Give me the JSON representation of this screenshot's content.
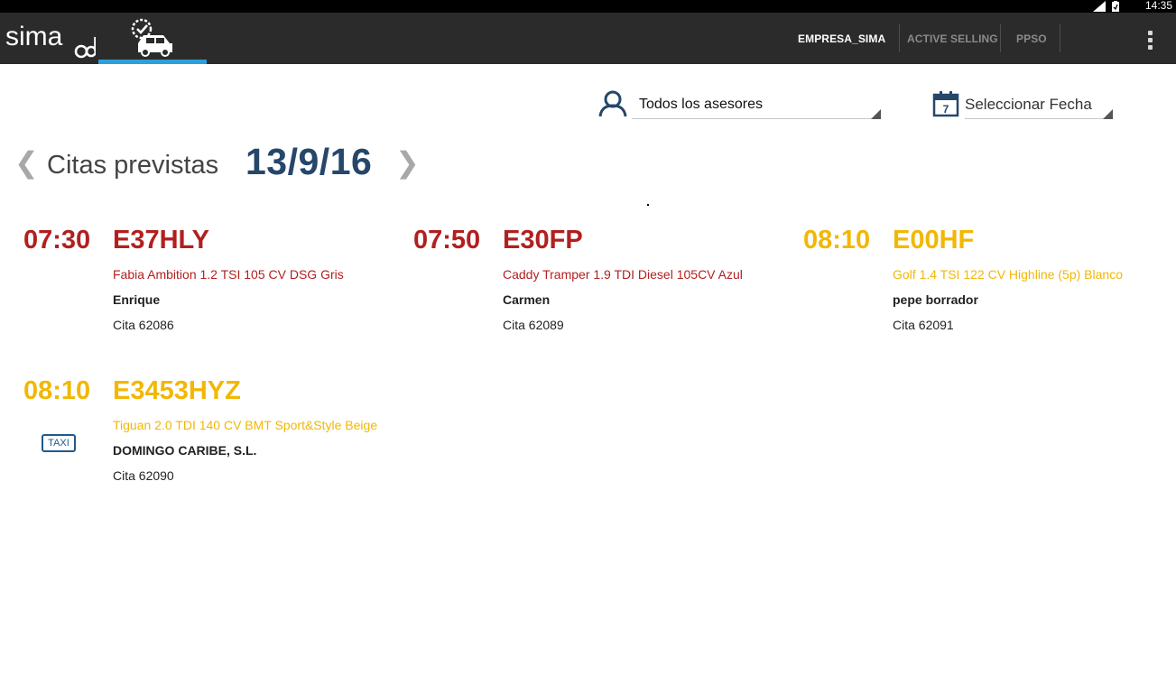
{
  "status_bar": {
    "time": "14:35"
  },
  "app": {
    "logo_text": "sima"
  },
  "menu": {
    "items": [
      {
        "label": "EMPRESA_SIMA",
        "active": true
      },
      {
        "label": "ACTIVE SELLING",
        "active": false
      },
      {
        "label": "PPSO",
        "active": false
      }
    ]
  },
  "filters": {
    "advisor": "Todos los asesores",
    "date_placeholder": "Seleccionar Fecha",
    "calendar_day": "7"
  },
  "schedule": {
    "heading": "Citas previstas",
    "date": "13/9/16",
    "prev": "❮",
    "next": "❯"
  },
  "appointments": [
    {
      "time": "07:30",
      "plate": "E37HLY",
      "model": "Fabia Ambition 1.2 TSI 105 CV DSG Gris",
      "client": "Enrique",
      "cita": "Cita 62086",
      "status_color": "#b21f1f",
      "taxi": false
    },
    {
      "time": "07:50",
      "plate": "E30FP",
      "model": "Caddy Tramper 1.9 TDI Diesel 105CV Azul",
      "client": "Carmen",
      "cita": "Cita 62089",
      "status_color": "#b21f1f",
      "taxi": false
    },
    {
      "time": "08:10",
      "plate": "E00HF",
      "model": "Golf 1.4 TSI 122 CV Highline (5p) Blanco",
      "client": "pepe borrador",
      "cita": "Cita 62091",
      "status_color": "#f2b705",
      "taxi": false
    },
    {
      "time": "08:10",
      "plate": "E3453HYZ",
      "model": "Tiguan 2.0 TDI 140 CV BMT Sport&Style Beige",
      "client": "DOMINGO CARIBE, S.L.",
      "cita": "Cita 62090",
      "status_color": "#f2b705",
      "taxi": true,
      "taxi_label": "TAXI"
    }
  ],
  "colors": {
    "accent": "#2ba0db",
    "date": "#25476a",
    "late": "#b21f1f",
    "pending": "#f2b705"
  }
}
